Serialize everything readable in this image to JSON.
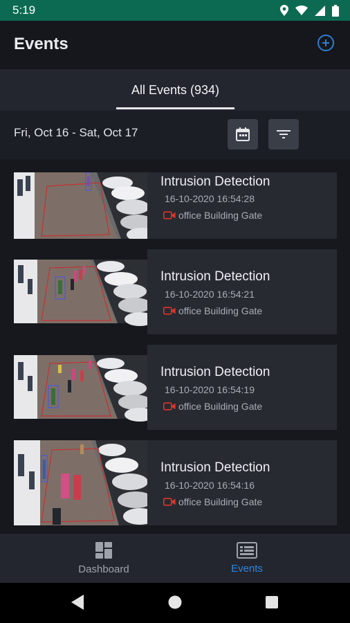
{
  "status_bar": {
    "time": "5:19"
  },
  "header": {
    "title": "Events"
  },
  "tabs": [
    {
      "label": "All Events (934)"
    }
  ],
  "filter_bar": {
    "date_range": "Fri, Oct 16 - Sat, Oct 17"
  },
  "events": [
    {
      "title": "Intrusion Detection",
      "timestamp": "16-10-2020 16:54:28",
      "camera": "office Building Gate"
    },
    {
      "title": "Intrusion Detection",
      "timestamp": "16-10-2020 16:54:21",
      "camera": "office Building Gate"
    },
    {
      "title": "Intrusion Detection",
      "timestamp": "16-10-2020 16:54:19",
      "camera": "office Building Gate"
    },
    {
      "title": "Intrusion Detection",
      "timestamp": "16-10-2020 16:54:16",
      "camera": "office Building Gate"
    }
  ],
  "bottom_nav": {
    "items": [
      {
        "label": "Dashboard",
        "icon": "dashboard-icon",
        "active": false
      },
      {
        "label": "Events",
        "icon": "events-icon",
        "active": true
      }
    ]
  },
  "colors": {
    "status_bar": "#0d6a52",
    "background": "#16181d",
    "card": "#272a31",
    "accent": "#2f86e0",
    "camera_icon": "#e0342b"
  },
  "icons": {
    "status": [
      "location-icon",
      "wifi-icon",
      "signal-icon",
      "battery-icon"
    ],
    "add": "add-circle-icon",
    "calendar": "calendar-icon",
    "filter": "filter-icon",
    "camera": "video-camera-icon",
    "system_nav": [
      "back-icon",
      "home-icon",
      "recents-icon"
    ]
  }
}
